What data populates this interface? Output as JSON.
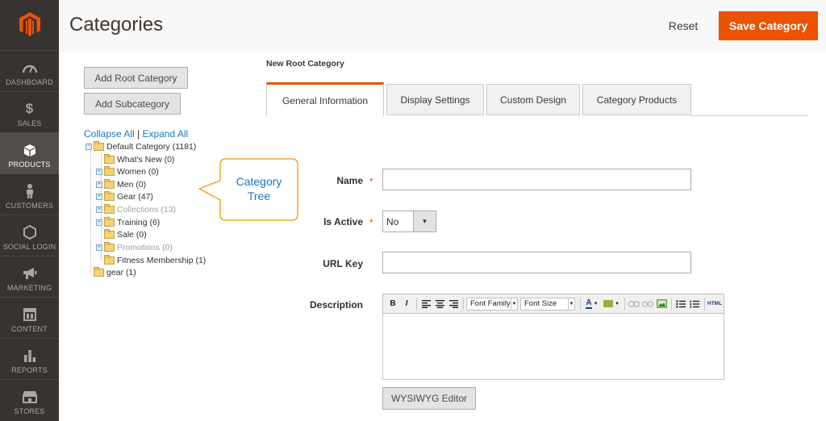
{
  "sidebar": {
    "items": [
      {
        "label": "DASHBOARD",
        "icon": "dashboard-icon"
      },
      {
        "label": "SALES",
        "icon": "dollar-icon"
      },
      {
        "label": "PRODUCTS",
        "icon": "cube-icon"
      },
      {
        "label": "CUSTOMERS",
        "icon": "person-icon"
      },
      {
        "label": "SOCIAL LOGIN",
        "icon": "hexagon-icon"
      },
      {
        "label": "MARKETING",
        "icon": "megaphone-icon"
      },
      {
        "label": "CONTENT",
        "icon": "layout-icon"
      },
      {
        "label": "REPORTS",
        "icon": "bar-chart-icon"
      },
      {
        "label": "STORES",
        "icon": "store-icon"
      }
    ],
    "active": "PRODUCTS"
  },
  "header": {
    "title": "Categories",
    "reset_label": "Reset",
    "save_label": "Save Category"
  },
  "left": {
    "add_root_label": "Add Root Category",
    "add_sub_label": "Add Subcategory",
    "collapse_all": "Collapse All",
    "sep": "|",
    "expand_all": "Expand All",
    "tree": [
      {
        "text": "Default Category (1181)"
      },
      {
        "text": "What's New (0)"
      },
      {
        "text": "Women (0)"
      },
      {
        "text": "Men (0)"
      },
      {
        "text": "Gear (47)"
      },
      {
        "text": "Collections (13)"
      },
      {
        "text": "Training (6)"
      },
      {
        "text": "Sale (0)"
      },
      {
        "text": "Promotions (0)"
      },
      {
        "text": "Fitness Membership (1)"
      },
      {
        "text": "gear (1)"
      }
    ]
  },
  "callout": {
    "line1": "Category",
    "line2": "Tree"
  },
  "main": {
    "section_title": "New Root Category",
    "tabs": [
      {
        "label": "General Information"
      },
      {
        "label": "Display Settings"
      },
      {
        "label": "Custom Design"
      },
      {
        "label": "Category Products"
      }
    ],
    "fields": {
      "name_label": "Name",
      "name_value": "",
      "is_active_label": "Is Active",
      "is_active_value": "No",
      "url_key_label": "URL Key",
      "url_key_value": "",
      "description_label": "Description",
      "required_mark": "*"
    },
    "editor": {
      "bold": "B",
      "italic": "I",
      "font_family": "Font Family",
      "font_size": "Font Size",
      "html": "HTML",
      "font_color": "A"
    },
    "wysiwyg_label": "WYSIWYG Editor"
  },
  "colors": {
    "accent": "#eb5202",
    "sidebar_bg": "#373330",
    "link": "#1979c3",
    "callout_border": "#f5a623"
  }
}
